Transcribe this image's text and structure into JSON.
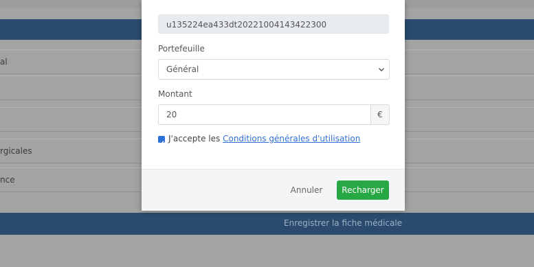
{
  "background": {
    "field_labels": [
      "al",
      "",
      "",
      "rgicales",
      "nce"
    ],
    "save_button_label": "Enregistrer la fiche médicale"
  },
  "modal": {
    "reference_value": "u135224ea433dt20221004143422300",
    "wallet_label": "Portefeuille",
    "wallet_selected": "Général",
    "amount_label": "Montant",
    "amount_value": "20",
    "currency_symbol": "€",
    "consent_prefix": "J'accepte les",
    "consent_link": "Conditions générales d'utilisation",
    "consent_checked": true,
    "cancel_label": "Annuler",
    "recharge_label": "Recharger"
  },
  "colors": {
    "primary_blue": "#2a4b6e",
    "success_green": "#28a745",
    "link_blue": "#2f6fd8"
  },
  "icons": [
    "chevron-down-icon",
    "checkbox-checked-icon"
  ]
}
